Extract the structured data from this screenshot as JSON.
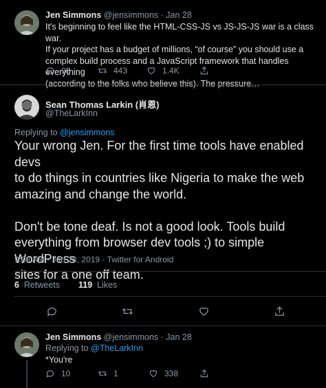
{
  "colors": {
    "background": "#000000",
    "secondary_text": "#8b98a5",
    "link": "#1da1f2",
    "divider": "#2f3336"
  },
  "tweet1": {
    "name": "Jen Simmons",
    "handle": "@jensimmons",
    "dot": "·",
    "date": "Jan 28",
    "lines": [
      "It's beginning to feel like the HTML-CSS-JS vs JS-JS-JS war is a class war.",
      "If your project has a budget of millions, “of course” you should use a",
      "complex build process and a JavaScript framework that handles everything",
      "(according to the folks who believe this). The pressure…"
    ],
    "replies": "98",
    "retweets": "443",
    "likes": "1.4K",
    "icons": [
      "reply-icon",
      "retweet-icon",
      "heart-icon",
      "share-icon"
    ]
  },
  "main": {
    "name": "Sean Thomas Larkin (肖恩)",
    "handle": "@TheLarkInn",
    "replying_prefix": "Replying to ",
    "replying_to": "@jensimmons",
    "paragraph1": [
      "Your wrong Jen. For the first time tools have enabled devs",
      "to do things in countries like Nigeria to make the web",
      "amazing and change the world."
    ],
    "paragraph2": [
      "Don't be tone deaf. Is not a good look. Tools build",
      "everything from browser dev tools ;) to simple WordPress",
      "sites for a one off team."
    ],
    "time": "9:08 AM",
    "date": "Jan 28, 2019",
    "client": "Twitter for Android",
    "retweet_count": "6",
    "retweet_label": "Retweets",
    "like_count": "119",
    "like_label": "Likes"
  },
  "tweet3": {
    "name": "Jen Simmons",
    "handle": "@jensimmons",
    "dot": "·",
    "date": "Jan 28",
    "replying_prefix": "Replying to ",
    "replying_to": "@TheLarkInn",
    "text": "*You're",
    "replies": "10",
    "retweets": "1",
    "likes": "338"
  }
}
